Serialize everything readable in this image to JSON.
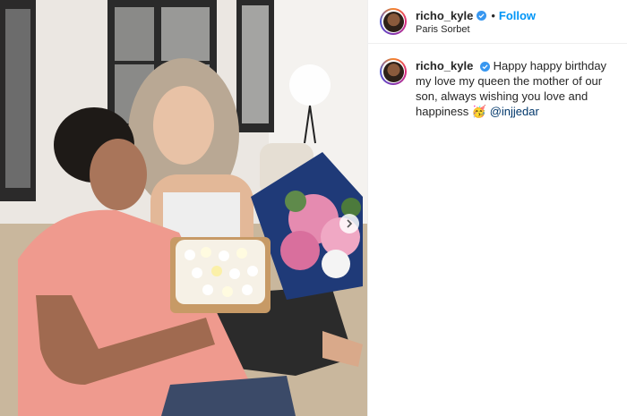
{
  "header": {
    "username": "richo_kyle",
    "follow_label": "Follow",
    "separator": "•",
    "location": "Paris Sorbet"
  },
  "caption": {
    "username": "richo_kyle",
    "text": "Happy happy birthday my love my queen the mother of our son, always wishing you love and happiness",
    "emoji": "🥳",
    "mention": "@injjedar"
  },
  "icons": {
    "verified": "verified-badge-icon",
    "next": "chevron-right-icon"
  },
  "colors": {
    "accent": "#0095f6",
    "text": "#262626",
    "mention": "#00376b"
  }
}
